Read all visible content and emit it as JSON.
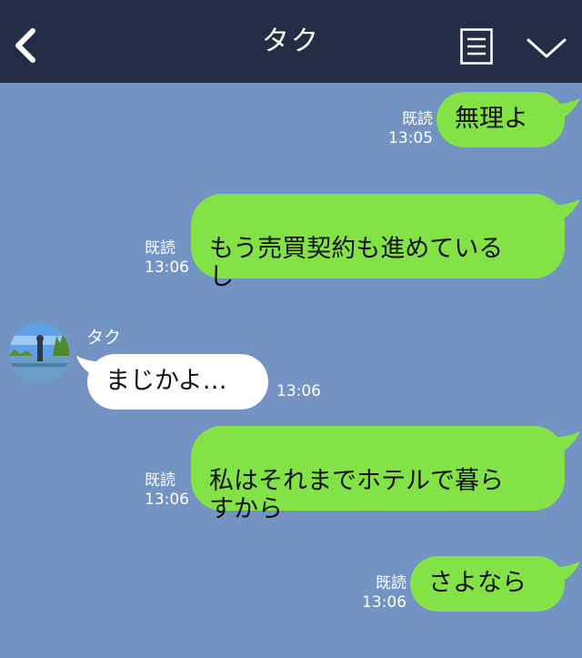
{
  "header": {
    "title": "タク"
  },
  "messages": [
    {
      "text": "無理よ",
      "read": "既読",
      "time": "13:05"
    },
    {
      "text": "もう売買契約も進めている\nし",
      "read": "既読",
      "time": "13:06"
    },
    {
      "sender": "タク",
      "text": "まじかよ…",
      "time": "13:06"
    },
    {
      "text": "私はそれまでホテルで暮ら\nすから",
      "read": "既読",
      "time": "13:06"
    },
    {
      "text": "さよなら",
      "read": "既読",
      "time": "13:06"
    }
  ],
  "colors": {
    "header_bg": "#232d46",
    "chat_bg": "#7393c2",
    "my_bubble": "#83e346",
    "their_bubble": "#ffffff"
  },
  "icons": [
    "back-arrow-icon",
    "menu-list-icon",
    "chevron-down-icon"
  ]
}
